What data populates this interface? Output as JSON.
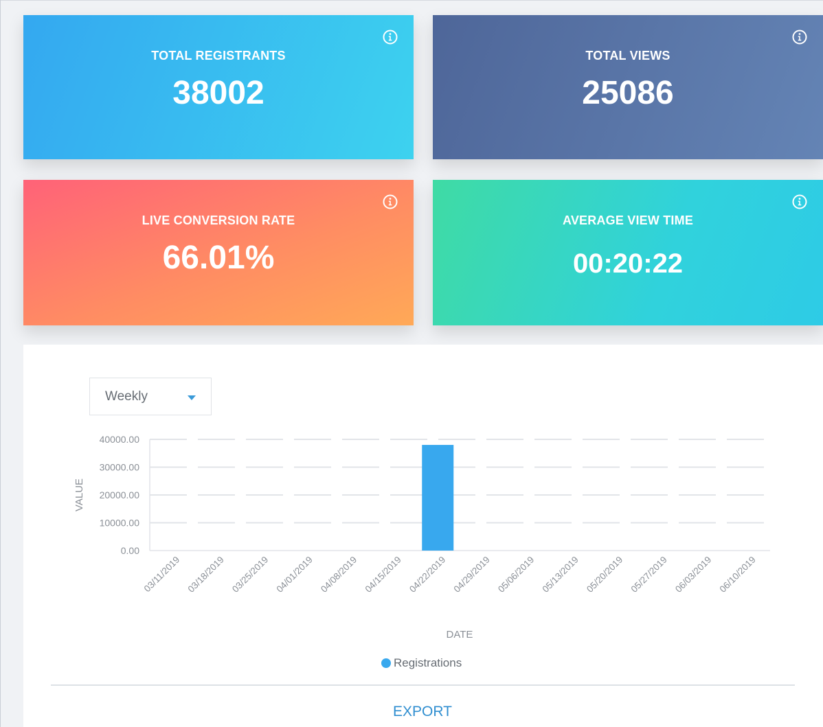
{
  "cards": [
    {
      "title": "TOTAL REGISTRANTS",
      "value": "38002",
      "icon": "info-icon"
    },
    {
      "title": "TOTAL VIEWS",
      "value": "25086",
      "icon": "info-icon"
    },
    {
      "title": "LIVE CONVERSION RATE",
      "value": "66.01%",
      "icon": "info-icon"
    },
    {
      "title": "AVERAGE VIEW TIME",
      "value": "00:20:22",
      "icon": "info-icon"
    }
  ],
  "period_select": {
    "selected": "Weekly",
    "icon": "chevron-down-icon"
  },
  "export_label": "EXPORT",
  "colors": {
    "series": "#38a8ee",
    "link": "#2f8ed0"
  },
  "chart_data": {
    "type": "bar",
    "xlabel": "DATE",
    "ylabel": "VALUE",
    "ylim": [
      0,
      40000
    ],
    "yticks": [
      "40000.00",
      "30000.00",
      "20000.00",
      "10000.00",
      "0.00"
    ],
    "categories": [
      "03/11/2019",
      "03/18/2019",
      "03/25/2019",
      "04/01/2019",
      "04/08/2019",
      "04/15/2019",
      "04/22/2019",
      "04/29/2019",
      "05/06/2019",
      "05/13/2019",
      "05/20/2019",
      "05/27/2019",
      "06/03/2019",
      "06/10/2019"
    ],
    "series": [
      {
        "name": "Registrations",
        "values": [
          0,
          0,
          0,
          0,
          0,
          0,
          38002,
          0,
          0,
          0,
          0,
          0,
          0,
          0
        ]
      }
    ],
    "grid": true,
    "legend": "bottom"
  }
}
